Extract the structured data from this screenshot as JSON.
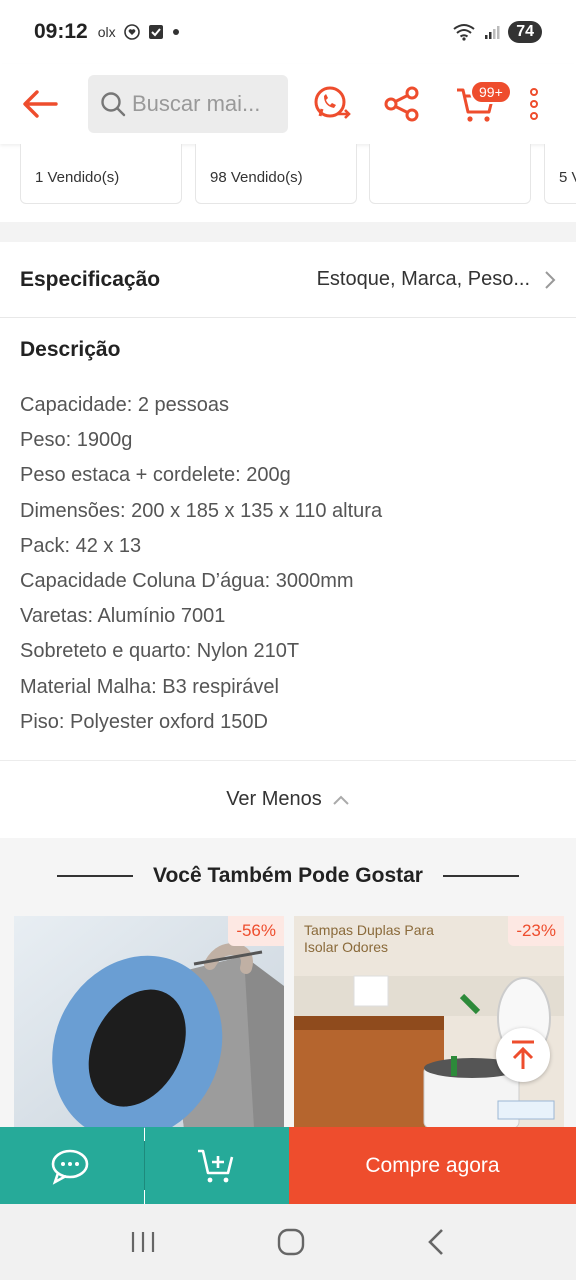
{
  "status_bar": {
    "time": "09:12",
    "app_icons": "olx",
    "battery": "74"
  },
  "search": {
    "placeholder": "Buscar mai..."
  },
  "cart": {
    "badge": "99+"
  },
  "strip_cards": [
    {
      "sold": "1 Vendido(s)"
    },
    {
      "sold": "98 Vendido(s)"
    },
    {
      "sold": ""
    },
    {
      "sold": "5 V"
    }
  ],
  "spec": {
    "title": "Especificação",
    "value": "Estoque, Marca, Peso..."
  },
  "description": {
    "title": "Descrição",
    "lines": [
      "Capacidade: 2 pessoas",
      "Peso: 1900g",
      "Peso estaca + cordelete: 200g",
      "Dimensões: 200 x 185 x 135 x 110 altura",
      "Pack: 42 x 13",
      "Capacidade Coluna D’água: 3000mm",
      "Varetas: Alumínio 7001",
      "Sobreteto e quarto: Nylon 210T",
      "Material Malha: B3 respirável",
      "Piso: Polyester oxford 150D"
    ]
  },
  "toggle": {
    "label": "Ver Menos"
  },
  "recommendations": {
    "title": "Você Também Pode Gostar",
    "items": [
      {
        "discount": "-56%"
      },
      {
        "discount": "-23%",
        "image_text": "Tampas Duplas Para Isolar Odores"
      }
    ]
  },
  "bottom_bar": {
    "buy_label": "Compre agora"
  },
  "colors": {
    "accent": "#ee4d2d",
    "teal": "#26aa99"
  }
}
